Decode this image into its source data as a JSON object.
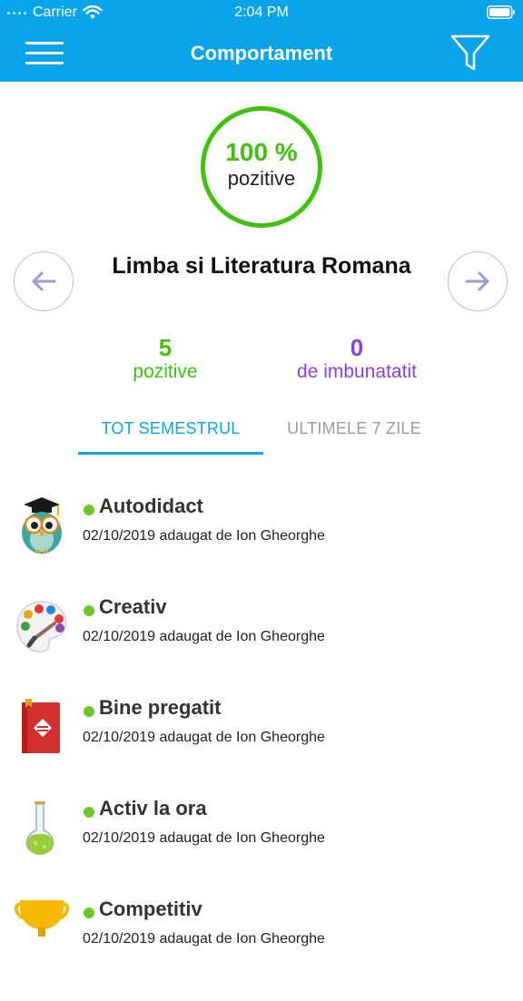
{
  "status_bar": {
    "carrier": "Carrier",
    "time": "2:04 PM"
  },
  "header": {
    "title": "Comportament",
    "menu_icon": "hamburger-menu-icon",
    "filter_icon": "funnel-filter-icon",
    "color": "#0aa4ea"
  },
  "summary": {
    "percent": "100 %",
    "percent_label": "pozitive",
    "subject": "Limba si Literatura Romana",
    "positive_count": "5",
    "positive_label": "pozitive",
    "improve_count": "0",
    "improve_label": "de imbunatatit",
    "colors": {
      "positive": "#3ec10f",
      "improve": "#8a3fe0"
    }
  },
  "tabs": [
    {
      "label": "TOT SEMESTRUL",
      "active": true
    },
    {
      "label": "ULTIMELE 7 ZILE",
      "active": false
    }
  ],
  "behaviors": [
    {
      "title": "Autodidact",
      "meta": "02/10/2019 adaugat de Ion Gheorghe",
      "icon": "owl-graduate-icon"
    },
    {
      "title": "Creativ",
      "meta": "02/10/2019 adaugat de Ion Gheorghe",
      "icon": "paint-palette-icon"
    },
    {
      "title": "Bine pregatit",
      "meta": "02/10/2019 adaugat de Ion Gheorghe",
      "icon": "red-book-icon"
    },
    {
      "title": "Activ la ora",
      "meta": "02/10/2019 adaugat de Ion Gheorghe",
      "icon": "flask-icon"
    },
    {
      "title": "Competitiv",
      "meta": "02/10/2019 adaugat de Ion Gheorghe",
      "icon": "trophy-icon"
    }
  ]
}
